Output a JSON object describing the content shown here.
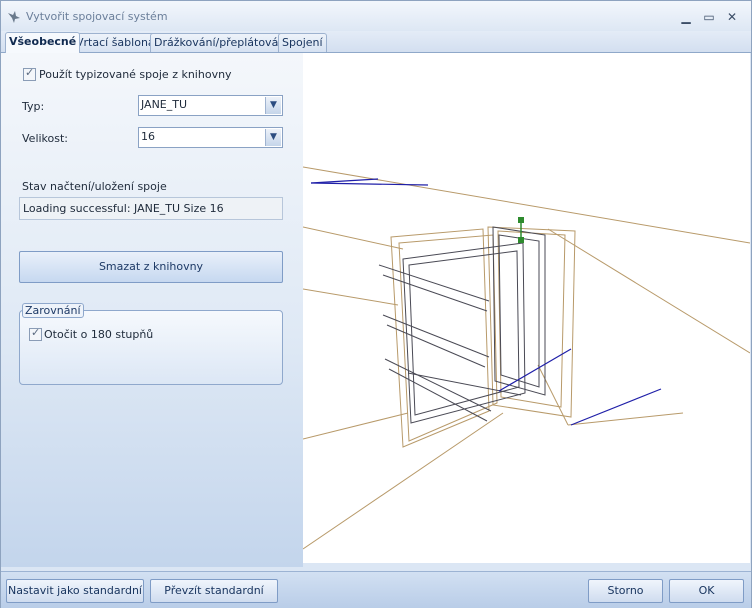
{
  "window": {
    "title": "Vytvořit spojovací systém",
    "minimize_glyph": "▁",
    "maximize_glyph": "▭",
    "close_glyph": "✕"
  },
  "tabs": [
    {
      "label": "Všeobecné",
      "active": true
    },
    {
      "label": "Vrtací šablona",
      "active": false
    },
    {
      "label": "Drážkování/přeplátování",
      "active": false
    },
    {
      "label": "Spojení",
      "active": false
    }
  ],
  "general": {
    "use_library_checkbox": {
      "label": "Použít typizované spoje z knihovny",
      "checked": true
    },
    "type": {
      "label": "Typ:",
      "value": "JANE_TU"
    },
    "size": {
      "label": "Velikost:",
      "value": "16"
    },
    "status": {
      "label": "Stav načtení/uložení spoje",
      "value": "Loading successful: JANE_TU Size 16"
    },
    "delete_button": "Smazat z knihovny",
    "alignment_group": {
      "title": "Zarovnání",
      "rotate_checkbox": {
        "label": "Otočit o 180 stupňů",
        "checked": true
      }
    }
  },
  "footer": {
    "set_default": "Nastavit jako standardní",
    "take_default": "Převzít standardní",
    "cancel": "Storno",
    "ok": "OK"
  },
  "icons": [
    "app-eagle-icon",
    "minimize-icon",
    "maximize-icon",
    "close-icon",
    "chevron-down-icon"
  ],
  "colors": {
    "accent": "#8aa2c4",
    "model_lines": "#b89a6a",
    "axis_blue": "#1f1fa8",
    "handle_green": "#2e8b2e"
  }
}
